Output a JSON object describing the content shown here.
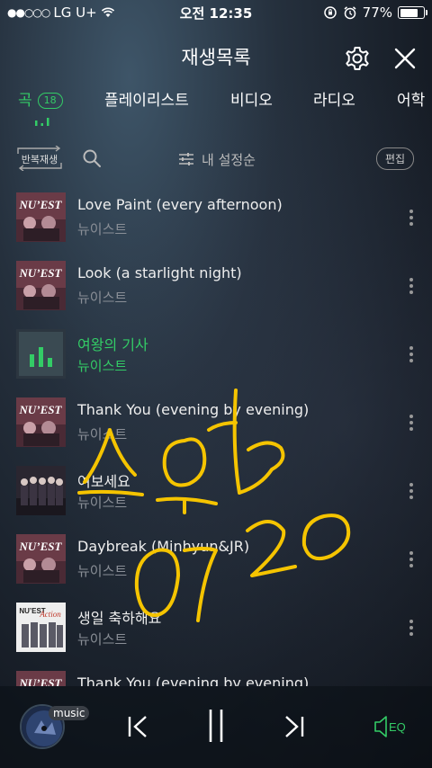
{
  "status_bar": {
    "signal": "●●○○○",
    "carrier": "LG U+",
    "time": "오전 12:35",
    "battery": "77%",
    "battery_level": 0.77
  },
  "header": {
    "title": "재생목록"
  },
  "tabs": [
    {
      "label": "곡",
      "badge": "18",
      "active": true
    },
    {
      "label": "플레이리스트"
    },
    {
      "label": "비디오"
    },
    {
      "label": "라디오"
    },
    {
      "label": "어학"
    }
  ],
  "toolbar": {
    "repeat_label": "반복재생",
    "sort_label": "내 설정순",
    "edit_label": "편집"
  },
  "songs": [
    {
      "title": "Love Paint (every afternoon)",
      "artist": "뉴이스트",
      "art": "nuest-cover"
    },
    {
      "title": "Look (a starlight night)",
      "artist": "뉴이스트",
      "art": "nuest-cover"
    },
    {
      "title": "여왕의 기사",
      "artist": "뉴이스트",
      "art": "now-playing",
      "current": true
    },
    {
      "title": "Thank You (evening by evening)",
      "artist": "뉴이스트",
      "art": "nuest-cover"
    },
    {
      "title": "여보세요",
      "artist": "뉴이스트",
      "art": "group-photo"
    },
    {
      "title": "Daybreak (Minhyun&JR)",
      "artist": "뉴이스트",
      "art": "nuest-cover"
    },
    {
      "title": "생일 축하해요",
      "artist": "뉴이스트",
      "art": "action-cover"
    },
    {
      "title": "Thank You (evening by evening)",
      "artist": "",
      "art": "nuest-cover"
    }
  ],
  "player": {
    "badge": "music",
    "eq_label": "EQ"
  },
  "colors": {
    "accent": "#33cc66",
    "handwriting": "#f5c400"
  }
}
